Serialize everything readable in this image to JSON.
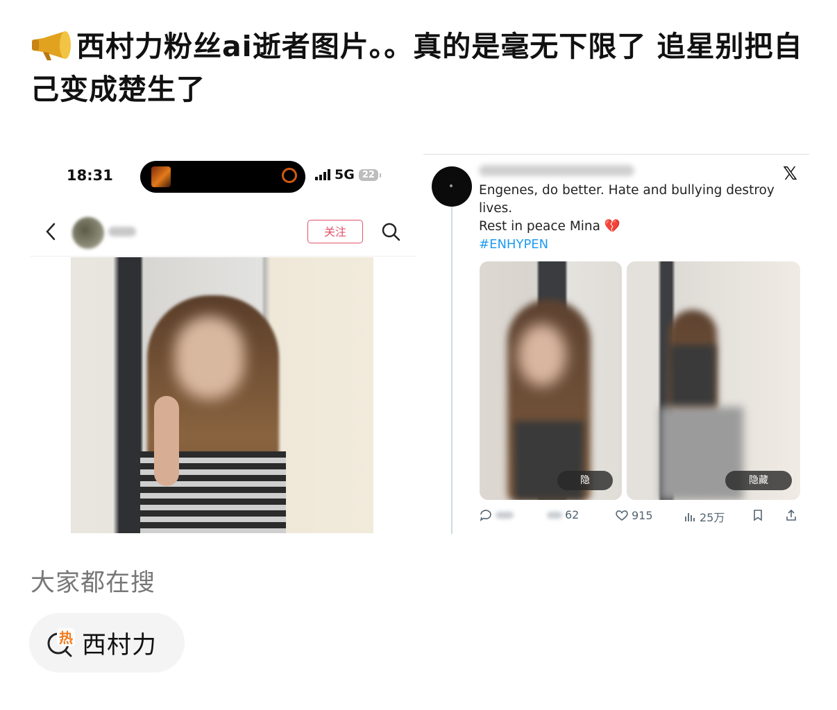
{
  "post": {
    "title": "西村力粉丝ai逝者图片。。真的是毫无下限了 追星别把自己变成楚生了",
    "title_icon": "megaphone-icon"
  },
  "left_screenshot": {
    "status_time": "18:31",
    "network": "5G",
    "battery": "22",
    "follow_label": "关注"
  },
  "right_screenshot": {
    "platform_icon": "x-logo-icon",
    "tweet_line1": "Engenes, do better. Hate and bullying destroy lives.",
    "tweet_line2": "Rest in peace Mina",
    "hashtag": "#ENHYPEN",
    "image_hidden_label_1": "隐",
    "image_hidden_label_2": "隐藏",
    "retweets": "62",
    "likes": "915",
    "views": "25万"
  },
  "search_section": {
    "heading": "大家都在搜",
    "hot_label": "西村力",
    "hot_badge": "热"
  },
  "colors": {
    "accent_pink": "#e0526a",
    "link_blue": "#1d9bf0",
    "heart_red": "#d0253c"
  }
}
